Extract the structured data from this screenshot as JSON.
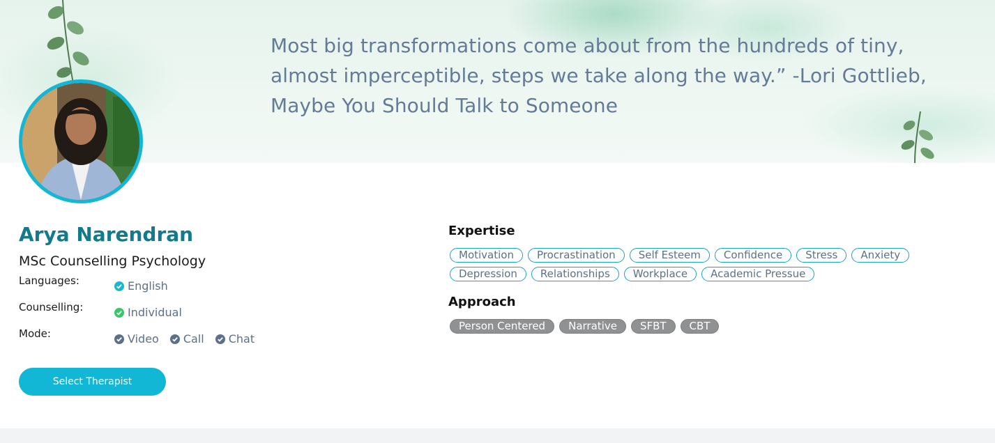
{
  "quote": {
    "text": "Most big transformations come about from the hundreds of tiny, almost imperceptible, steps we take along the way.” -Lori Gottlieb, Maybe You Should Talk to Someone"
  },
  "profile": {
    "name": "Arya Narendran",
    "degree": "MSc Counselling Psychology",
    "languages_label": "Languages:",
    "languages": [
      "English"
    ],
    "counselling_label": "Counselling:",
    "counselling": [
      "Individual"
    ],
    "mode_label": "Mode:",
    "modes": [
      "Video",
      "Call",
      "Chat"
    ],
    "select_button": "Select Therapist"
  },
  "expertise": {
    "title": "Expertise",
    "tags": [
      "Motivation",
      "Procrastination",
      "Self Esteem",
      "Confidence",
      "Stress",
      "Anxiety",
      "Depression",
      "Relationships",
      "Workplace",
      "Academic Pressue"
    ]
  },
  "approach": {
    "title": "Approach",
    "tags": [
      "Person Centered",
      "Narrative",
      "SFBT",
      "CBT"
    ]
  },
  "colors": {
    "accent": "#12b7d6",
    "name": "#117a8b",
    "quote": "#647b97",
    "check_language": "#1cb5d4",
    "check_counselling": "#3cc46a",
    "check_mode": "#5c7189",
    "approach_tag": "#8f9192"
  },
  "icons": {
    "check": "check-circle-icon",
    "leaf": "eucalyptus-leaf-decoration"
  }
}
